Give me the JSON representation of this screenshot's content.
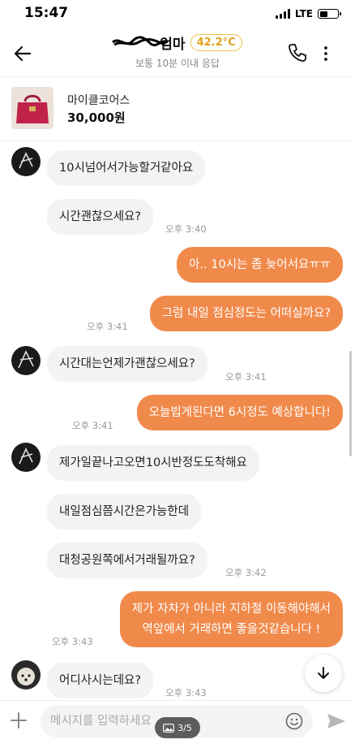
{
  "status": {
    "time": "15:47",
    "network": "LTE"
  },
  "header": {
    "name": "엄마",
    "temperature": "42.2°C",
    "subtitle": "보통 10분 이내 응답"
  },
  "product": {
    "title": "마이클코어스",
    "price": "30,000원"
  },
  "messages": [
    {
      "side": "in",
      "text": "10시넘어서가능할거같아요"
    },
    {
      "side": "in",
      "text": "시간괜찮으세요?",
      "time": "오후 3:40"
    },
    {
      "side": "out",
      "text": "아.. 10시는 좀 늦어서요ㅠㅠ"
    },
    {
      "side": "out",
      "text": "그럼 내일 점심정도는 어떠실까요?",
      "time": "오후 3:41"
    },
    {
      "side": "in",
      "text": "시간대는언제가괜찮으세요?",
      "time": "오후 3:41"
    },
    {
      "side": "out",
      "text": "오늘빕게된다면 6시정도 예상합니다!",
      "time": "오후 3:41"
    },
    {
      "side": "in",
      "text": "제가일끝나고오면10시반정도도착해요"
    },
    {
      "side": "in",
      "text": "내일점심쯤시간은가능한데"
    },
    {
      "side": "in",
      "text": "대청공원쪽에서거래될까요?",
      "time": "오후 3:42"
    },
    {
      "side": "out",
      "text_line1": "제가 자차가 아니라 지하철 이동해야해서",
      "text_line2": "역앞에서 거래하면 좋을것같습니다 !",
      "time": "오후 3:43"
    },
    {
      "side": "in",
      "text": "어디사시는데요?",
      "time": "오후 3:43"
    }
  ],
  "input": {
    "placeholder": "메시지를 입력하세요"
  },
  "page_indicator": "3/5",
  "colors": {
    "accent": "#f08a4b",
    "incoming_bubble": "#f2f3f5",
    "temperature": "#e0a21b"
  },
  "icons": [
    "back-arrow-icon",
    "phone-icon",
    "more-vertical-icon",
    "chevron-down-icon",
    "plus-icon",
    "emoji-icon",
    "send-icon",
    "image-icon"
  ]
}
